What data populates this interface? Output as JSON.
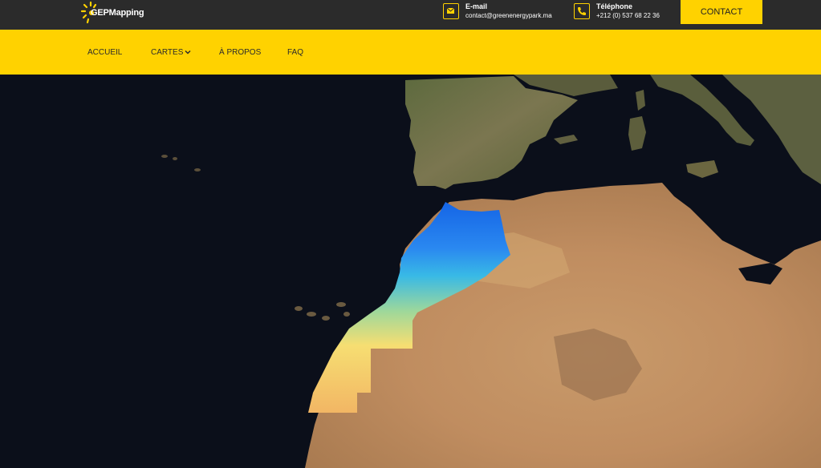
{
  "brand": {
    "name": "GEPMapping",
    "logo_icon": "sun-logo-icon"
  },
  "contact": {
    "email_title": "E-mail",
    "email_value": "contact@greenenergypark.ma",
    "phone_title": "Téléphone",
    "phone_value": "+212 (0) 537 68 22 36",
    "button_label": "CONTACT"
  },
  "nav": {
    "items": [
      {
        "label": "ACCUEIL"
      },
      {
        "label": "CARTES",
        "icon": "chevron-down-icon"
      },
      {
        "label": "À PROPOS"
      },
      {
        "label": "FAQ"
      }
    ]
  },
  "colors": {
    "accent": "#ffd200",
    "topbar": "#2b2b2b",
    "ocean": "#0b0f1a"
  }
}
